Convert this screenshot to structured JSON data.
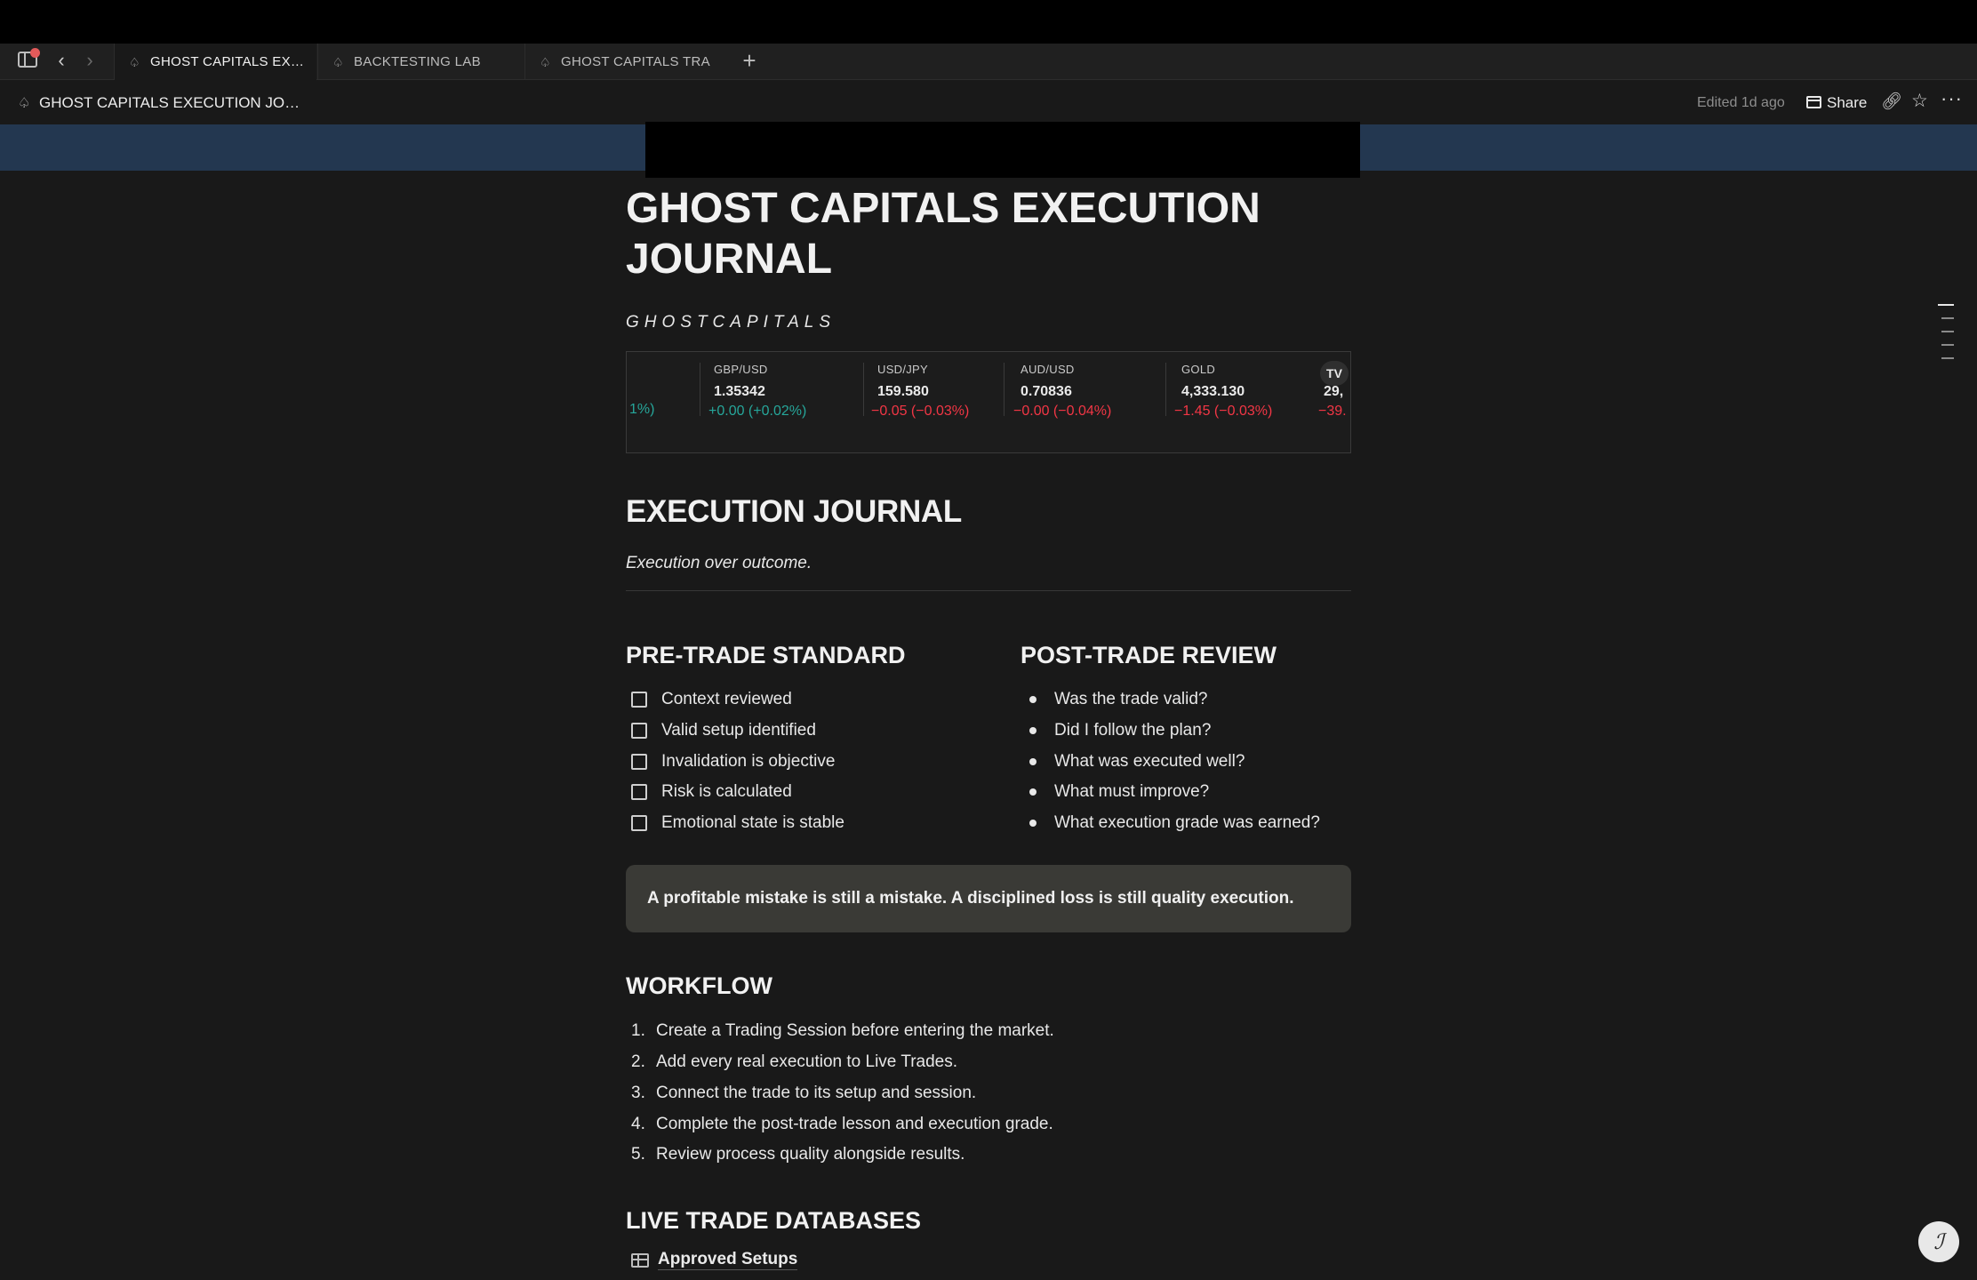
{
  "tabs": [
    {
      "label": "GHOST CAPITALS EX…",
      "active": true
    },
    {
      "label": "BACKTESTING LAB",
      "active": false
    },
    {
      "label": "GHOST CAPITALS TRA",
      "active": false
    }
  ],
  "header": {
    "title": "GHOST CAPITALS EXECUTION JO…",
    "edited": "Edited 1d ago",
    "share_label": "Share"
  },
  "page": {
    "title": "GHOST CAPITALS EXECUTION JOURNAL",
    "brand": "GHOSTCAPITALS"
  },
  "ticker": {
    "partial_change": "1%)",
    "items": [
      {
        "symbol": "GBP/USD",
        "price": "1.35342",
        "change": "+0.00 (+0.02%)",
        "direction": "up"
      },
      {
        "symbol": "USD/JPY",
        "price": "159.580",
        "change": "−0.05 (−0.03%)",
        "direction": "down"
      },
      {
        "symbol": "AUD/USD",
        "price": "0.70836",
        "change": "−0.00 (−0.04%)",
        "direction": "down"
      },
      {
        "symbol": "GOLD",
        "price": "4,333.130",
        "change": "−1.45 (−0.03%)",
        "direction": "down"
      },
      {
        "symbol": "",
        "price": "29,",
        "change": "−39.",
        "direction": "down"
      }
    ],
    "logo": "TV",
    "colors": {
      "up": "#26a69a",
      "down": "#f23645"
    }
  },
  "journal": {
    "heading": "EXECUTION JOURNAL",
    "tagline": "Execution over outcome."
  },
  "pretrade": {
    "heading": "PRE-TRADE STANDARD",
    "items": [
      "Context reviewed",
      "Valid setup identified",
      "Invalidation is objective",
      "Risk is calculated",
      "Emotional state is stable"
    ]
  },
  "posttrade": {
    "heading": "POST-TRADE REVIEW",
    "items": [
      "Was the trade valid?",
      "Did I follow the plan?",
      "What was executed well?",
      "What must improve?",
      "What execution grade was earned?"
    ]
  },
  "callout": {
    "text": "A profitable mistake is still a mistake. A disciplined loss is still quality execution."
  },
  "workflow": {
    "heading": "WORKFLOW",
    "steps": [
      "Create a Trading Session before entering the market.",
      "Add every real execution to Live Trades.",
      "Connect the trade to its setup and session.",
      "Complete the post-trade lesson and execution grade.",
      "Review process quality alongside results."
    ]
  },
  "databases": {
    "heading": "LIVE TRADE DATABASES",
    "items": [
      "Approved Setups"
    ]
  },
  "icons": {
    "sidebar": "sidebar-toggle-icon",
    "back": "chevron-left-icon",
    "forward": "chevron-right-icon",
    "page": "ghost-page-icon",
    "link": "link-icon",
    "star": "star-icon",
    "more": "more-icon",
    "help": "help-icon"
  },
  "colors": {
    "background": "#191919",
    "cover": "#233750",
    "callout_bg": "#3a3a36"
  }
}
